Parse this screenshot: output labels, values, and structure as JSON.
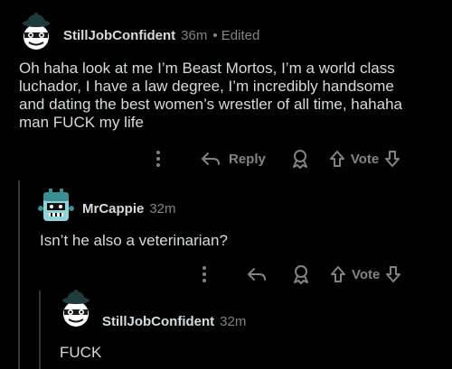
{
  "comments": [
    {
      "author": "StillJobConfident",
      "time": "36m",
      "edited": "• Edited",
      "text": "Oh haha look at me I’m Beast Mortos, I’m a world class luchador, I have a law degree, I’m incredibly handsome and dating the best women’s wrestler of all time, hahaha man FUCK my life",
      "actions": {
        "reply_label": "Reply",
        "vote_label": "Vote"
      }
    },
    {
      "author": "MrCappie",
      "time": "32m",
      "text": "Isn’t he also a veterinarian?",
      "actions": {
        "vote_label": "Vote"
      }
    },
    {
      "author": "StillJobConfident",
      "time": "32m",
      "text": "FUCK"
    }
  ],
  "icons": {
    "more": "more-vertical-icon",
    "reply": "reply-arrow-icon",
    "award": "award-icon",
    "upvote": "upvote-arrow-icon",
    "downvote": "downvote-arrow-icon"
  },
  "colors": {
    "background": "#000000",
    "text": "#d7dadc",
    "muted": "#818384",
    "thread_line": "#343536"
  }
}
